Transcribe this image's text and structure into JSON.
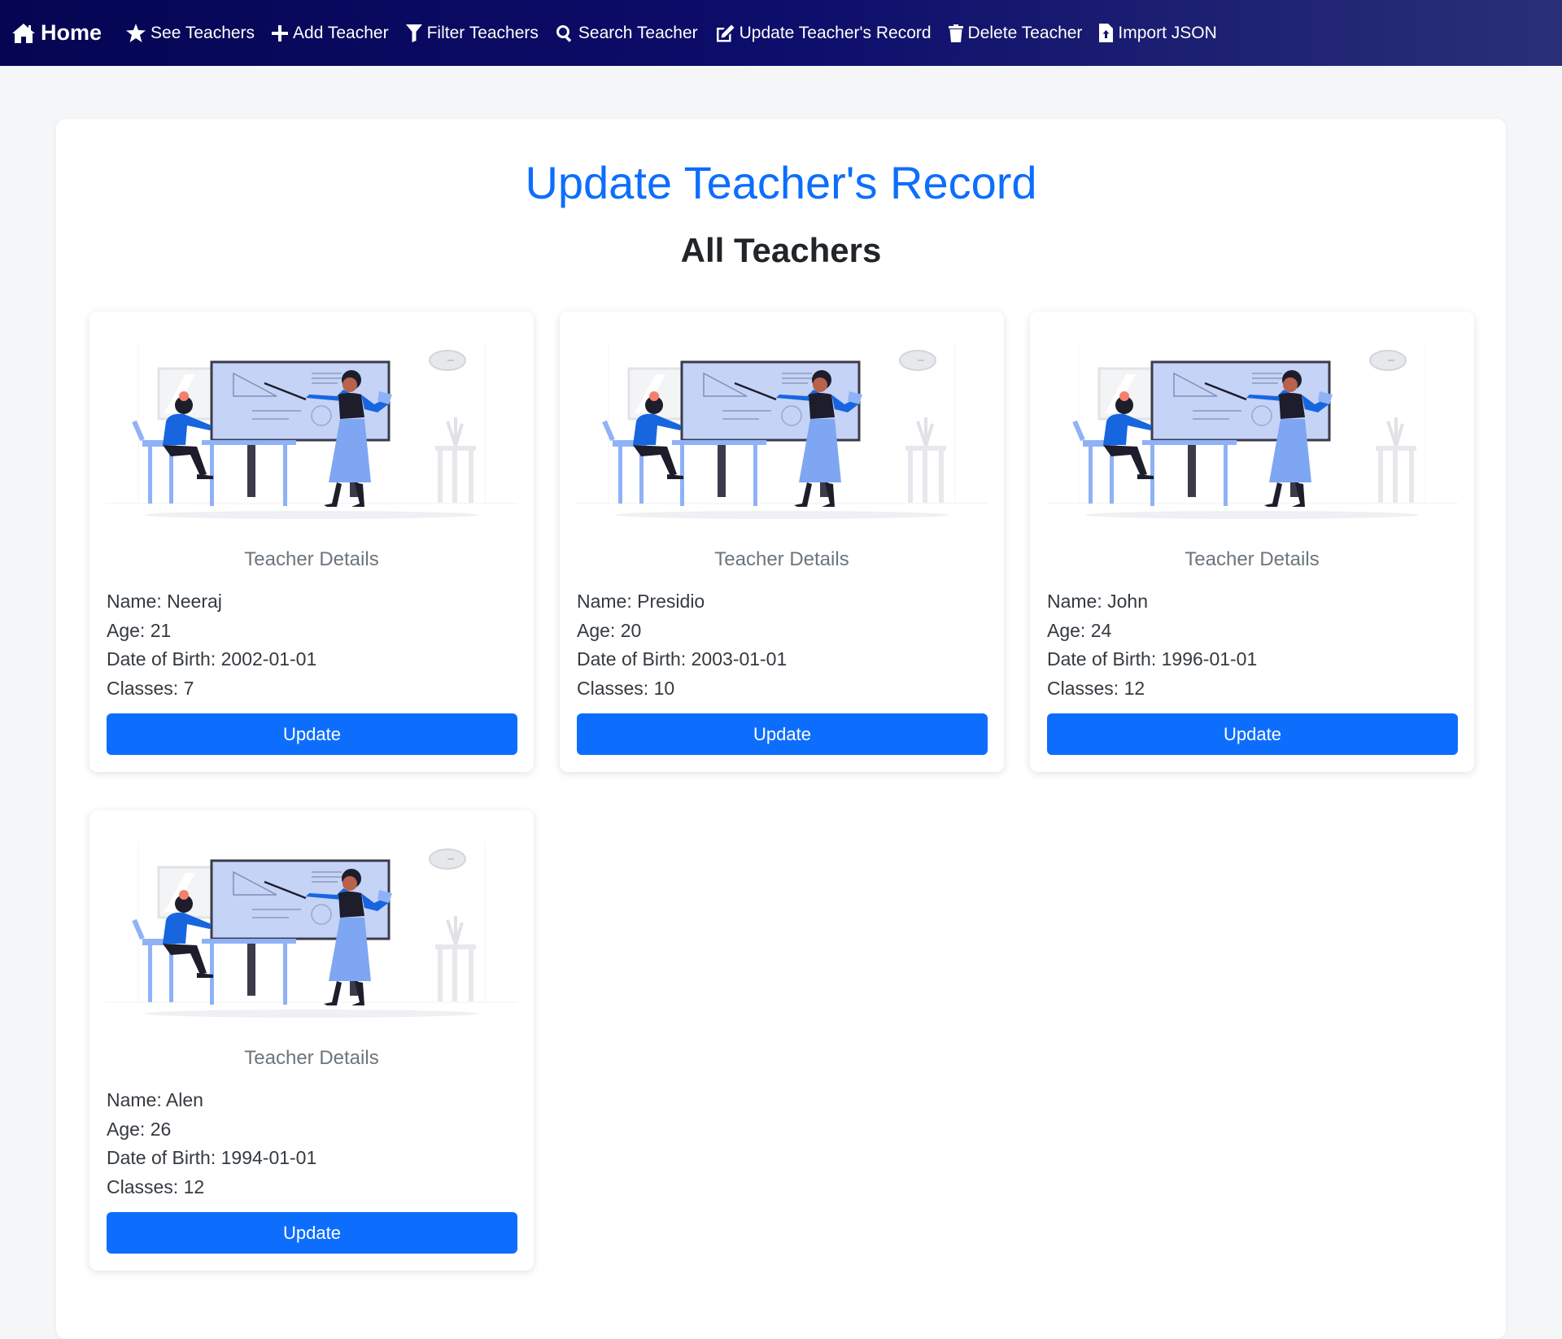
{
  "nav": {
    "brand": {
      "label": "Home",
      "icon": "home-icon"
    },
    "items": [
      {
        "label": "See Teachers",
        "icon": "star-icon"
      },
      {
        "label": "Add Teacher",
        "icon": "plus-icon"
      },
      {
        "label": "Filter Teachers",
        "icon": "filter-icon"
      },
      {
        "label": "Search Teacher",
        "icon": "search-icon"
      },
      {
        "label": "Update Teacher's Record",
        "icon": "edit-icon"
      },
      {
        "label": "Delete Teacher",
        "icon": "trash-icon"
      },
      {
        "label": "Import JSON",
        "icon": "file-import-icon"
      }
    ]
  },
  "main": {
    "title": "Update Teacher's Record",
    "section_title": "All Teachers"
  },
  "teachers": [
    {
      "subtitle": "Teacher Details",
      "name": "Name: Neeraj",
      "age": "Age: 21",
      "dob": "Date of Birth: 2002-01-01",
      "classes": "Classes: 7",
      "button": "Update"
    },
    {
      "subtitle": "Teacher Details",
      "name": "Name: Presidio",
      "age": "Age: 20",
      "dob": "Date of Birth: 2003-01-01",
      "classes": "Classes: 10",
      "button": "Update"
    },
    {
      "subtitle": "Teacher Details",
      "name": "Name: John",
      "age": "Age: 24",
      "dob": "Date of Birth: 1996-01-01",
      "classes": "Classes: 12",
      "button": "Update"
    },
    {
      "subtitle": "Teacher Details",
      "name": "Name: Alen",
      "age": "Age: 26",
      "dob": "Date of Birth: 1994-01-01",
      "classes": "Classes: 12",
      "button": "Update"
    }
  ],
  "colors": {
    "navbar": "#0a0a5e",
    "accent": "#0d6efd",
    "background": "#f5f6f8"
  }
}
